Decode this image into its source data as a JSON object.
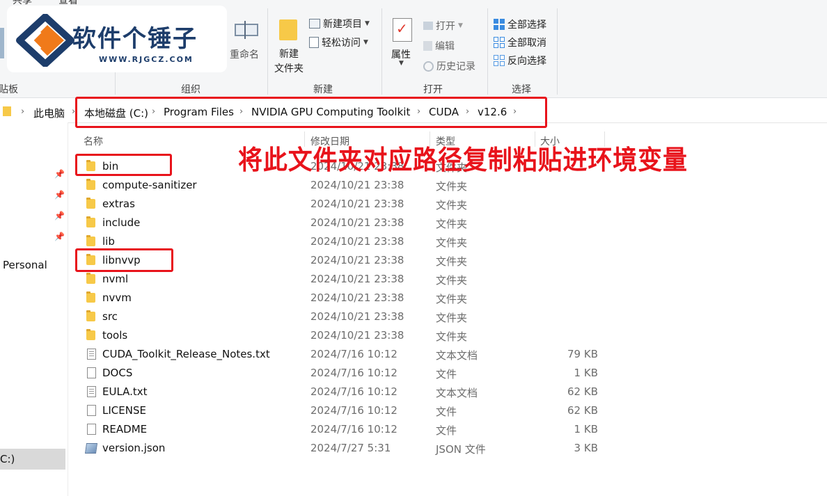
{
  "ribbon": {
    "tabs": [
      "共享",
      "查看"
    ],
    "groups": {
      "clipboard": {
        "label": "剪贴板",
        "label_cut": "贴板"
      },
      "organize": {
        "label": "组织",
        "rename": "重命名"
      },
      "new": {
        "label": "新建",
        "new_folder": "新建\n文件夹",
        "new_folder_l1": "新建",
        "new_folder_l2": "文件夹",
        "new_item": "新建项目",
        "easy_access": "轻松访问"
      },
      "open": {
        "label": "打开",
        "properties": "属性",
        "open": "打开",
        "edit": "编辑",
        "history": "历史记录"
      },
      "select": {
        "label": "选择",
        "select_all": "全部选择",
        "select_none": "全部取消",
        "invert": "反向选择"
      }
    }
  },
  "logo": {
    "title": "软件个锤子",
    "url": "WWW.RJGCZ.COM"
  },
  "address": {
    "crumbs": [
      "此电脑",
      "本地磁盘 (C:)",
      "Program Files",
      "NVIDIA GPU Computing Toolkit",
      "CUDA",
      "v12.6"
    ]
  },
  "columns": {
    "name": "名称",
    "date": "修改日期",
    "type": "类型",
    "size": "大小"
  },
  "annotation": "将此文件夹对应路径复制粘贴进环境变量",
  "nav": {
    "personal": "Personal",
    "drive": "C:)"
  },
  "files": [
    {
      "name": "bin",
      "date": "2024/10/21 23:38",
      "type": "文件夹",
      "size": "",
      "icon": "folder-icon"
    },
    {
      "name": "compute-sanitizer",
      "date": "2024/10/21 23:38",
      "type": "文件夹",
      "size": "",
      "icon": "folder-icon"
    },
    {
      "name": "extras",
      "date": "2024/10/21 23:38",
      "type": "文件夹",
      "size": "",
      "icon": "folder-icon"
    },
    {
      "name": "include",
      "date": "2024/10/21 23:38",
      "type": "文件夹",
      "size": "",
      "icon": "folder-icon"
    },
    {
      "name": "lib",
      "date": "2024/10/21 23:38",
      "type": "文件夹",
      "size": "",
      "icon": "folder-icon"
    },
    {
      "name": "libnvvp",
      "date": "2024/10/21 23:38",
      "type": "文件夹",
      "size": "",
      "icon": "folder-icon"
    },
    {
      "name": "nvml",
      "date": "2024/10/21 23:38",
      "type": "文件夹",
      "size": "",
      "icon": "folder-icon"
    },
    {
      "name": "nvvm",
      "date": "2024/10/21 23:38",
      "type": "文件夹",
      "size": "",
      "icon": "folder-icon"
    },
    {
      "name": "src",
      "date": "2024/10/21 23:38",
      "type": "文件夹",
      "size": "",
      "icon": "folder-icon"
    },
    {
      "name": "tools",
      "date": "2024/10/21 23:38",
      "type": "文件夹",
      "size": "",
      "icon": "folder-icon"
    },
    {
      "name": "CUDA_Toolkit_Release_Notes.txt",
      "date": "2024/7/16 10:12",
      "type": "文本文档",
      "size": "79 KB",
      "icon": "text-file-icon"
    },
    {
      "name": "DOCS",
      "date": "2024/7/16 10:12",
      "type": "文件",
      "size": "1 KB",
      "icon": "file-icon"
    },
    {
      "name": "EULA.txt",
      "date": "2024/7/16 10:12",
      "type": "文本文档",
      "size": "62 KB",
      "icon": "text-file-icon"
    },
    {
      "name": "LICENSE",
      "date": "2024/7/16 10:12",
      "type": "文件",
      "size": "62 KB",
      "icon": "file-icon"
    },
    {
      "name": "README",
      "date": "2024/7/16 10:12",
      "type": "文件",
      "size": "1 KB",
      "icon": "file-icon"
    },
    {
      "name": "version.json",
      "date": "2024/7/27 5:31",
      "type": "JSON 文件",
      "size": "3 KB",
      "icon": "json-file-icon"
    }
  ],
  "colors": {
    "annotation_red": "#e8131b",
    "folder_yellow": "#f7c948",
    "accent_blue": "#3a8be0"
  }
}
